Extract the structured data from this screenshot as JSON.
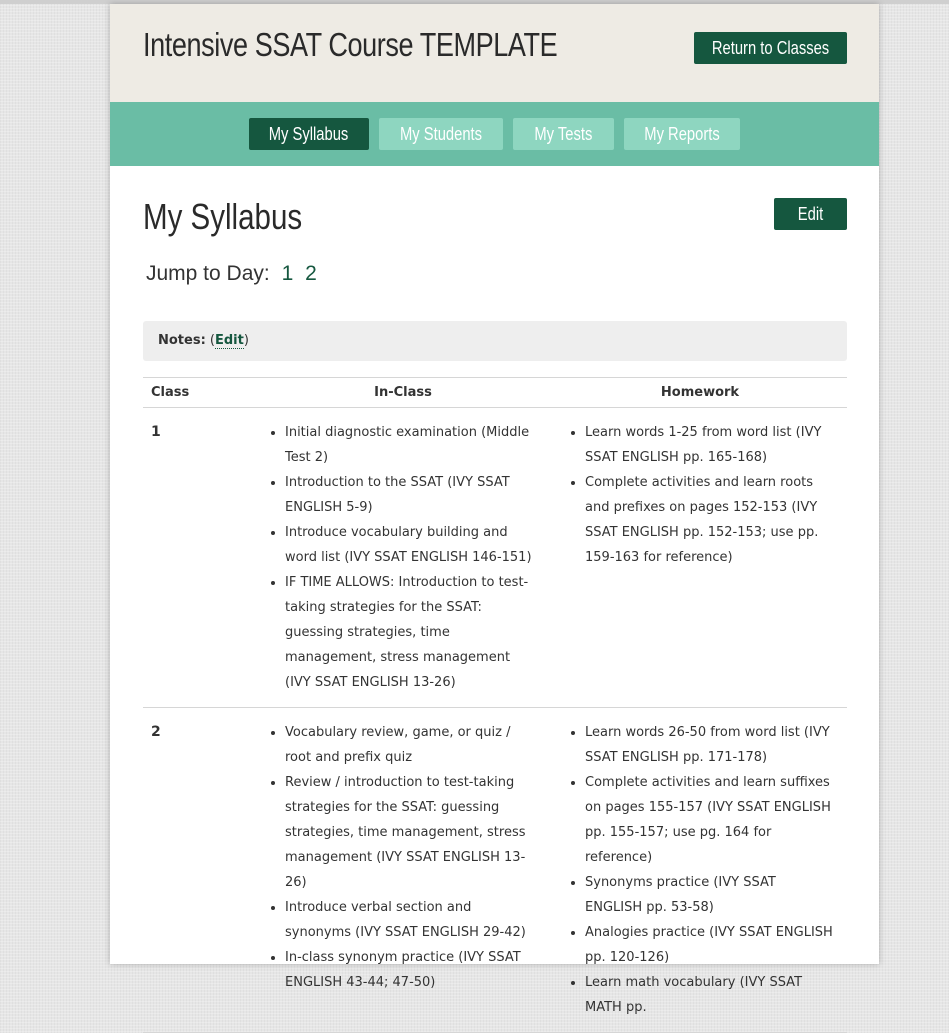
{
  "header": {
    "course_title": "Intensive SSAT Course TEMPLATE",
    "return_label": "Return to Classes"
  },
  "nav": {
    "tabs": [
      {
        "label": "My Syllabus",
        "active": true
      },
      {
        "label": "My Students",
        "active": false
      },
      {
        "label": "My Tests",
        "active": false
      },
      {
        "label": "My Reports",
        "active": false
      }
    ]
  },
  "main": {
    "title": "My Syllabus",
    "edit_label": "Edit",
    "jump_label": "Jump to Day:",
    "days": [
      "1",
      "2"
    ],
    "notes_label": "Notes:",
    "notes_edit": "Edit"
  },
  "table": {
    "headers": [
      "Class",
      "In-Class",
      "Homework"
    ],
    "rows": [
      {
        "class": "1",
        "in_class": [
          "Initial diagnostic examination (Middle Test 2)",
          "Introduction to the SSAT (IVY SSAT ENGLISH 5-9)",
          "Introduce vocabulary building and word list (IVY SSAT ENGLISH 146-151)",
          "IF TIME ALLOWS: Introduction to test-taking strategies for the SSAT: guessing strategies, time management, stress management (IVY SSAT ENGLISH 13-26)"
        ],
        "homework": [
          "Learn words 1-25 from word list (IVY SSAT ENGLISH pp. 165-168)",
          "Complete activities and learn roots and prefixes on pages 152-153 (IVY SSAT ENGLISH pp. 152-153; use pp. 159-163 for reference)"
        ]
      },
      {
        "class": "2",
        "in_class": [
          "Vocabulary review, game, or quiz / root and prefix quiz",
          "Review / introduction to test-taking strategies for the SSAT: guessing strategies, time management, stress management (IVY SSAT ENGLISH 13-26)",
          "Introduce verbal section and synonyms (IVY SSAT ENGLISH 29-42)",
          "In-class synonym practice (IVY SSAT ENGLISH 43-44; 47-50)"
        ],
        "homework": [
          "Learn words 26-50 from word list (IVY SSAT ENGLISH pp. 171-178)",
          "Complete activities and learn suffixes on pages 155-157 (IVY SSAT ENGLISH pp. 155-157; use pg. 164 for reference)",
          "Synonyms practice (IVY SSAT ENGLISH pp. 53-58)",
          "Analogies practice (IVY SSAT ENGLISH pp. 120-126)",
          "Learn math vocabulary (IVY SSAT MATH pp."
        ]
      }
    ]
  },
  "colors": {
    "primary_dark": "#15573f",
    "nav_bg": "#6abda5",
    "tab_inactive": "#8ed6c0",
    "header_bg": "#eeebe4"
  }
}
